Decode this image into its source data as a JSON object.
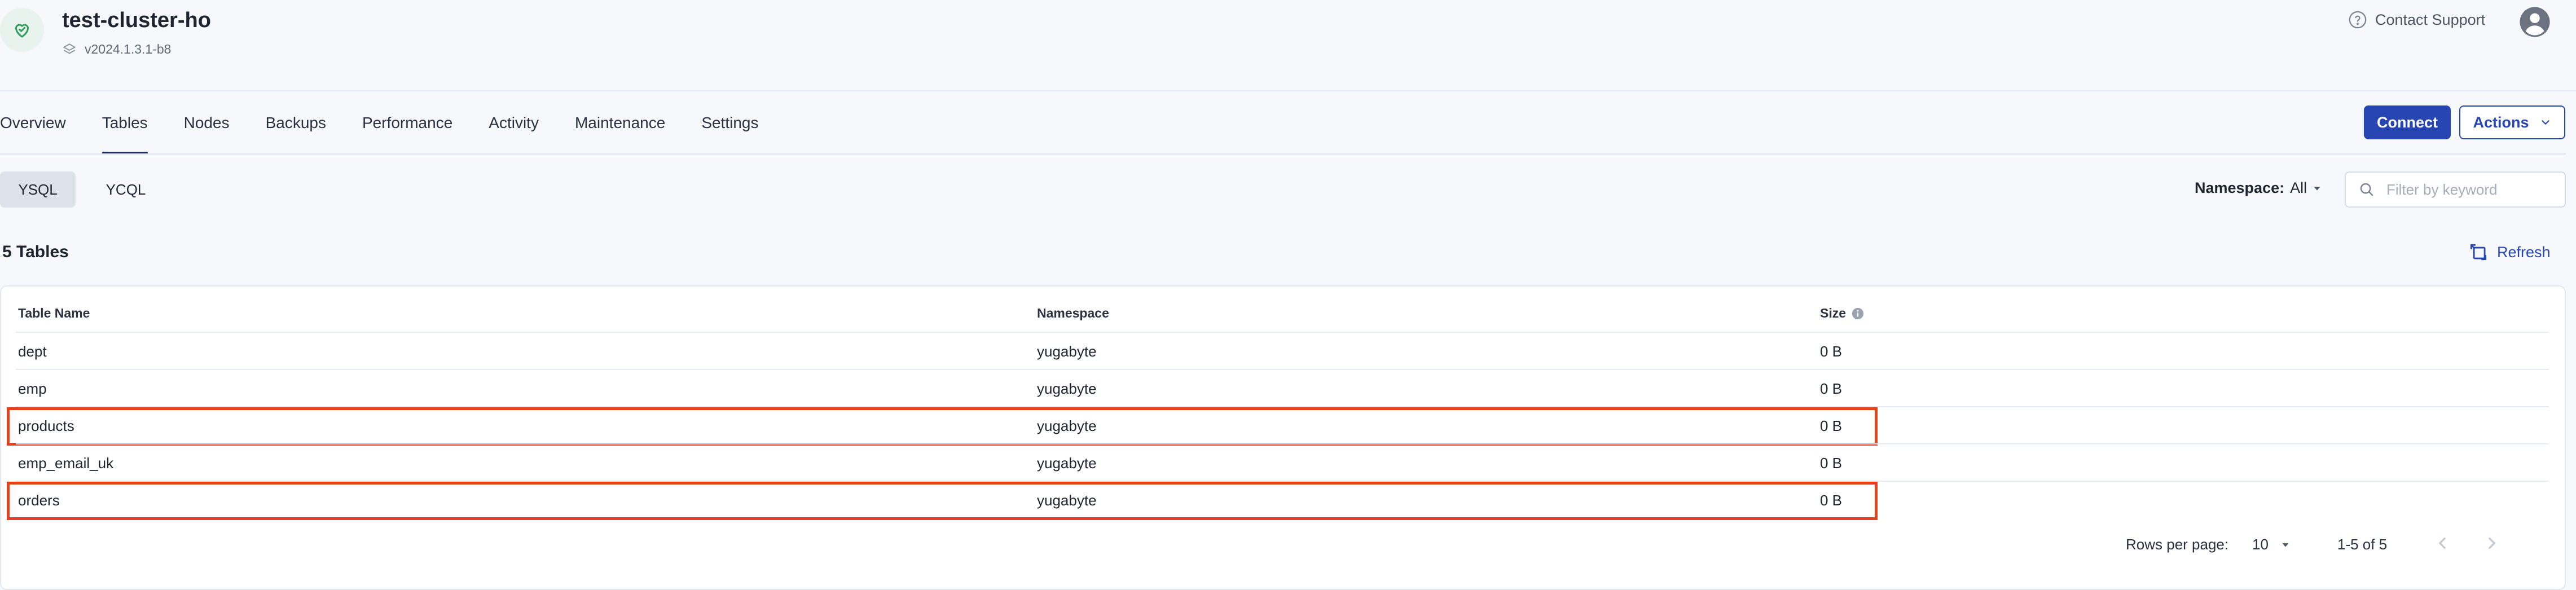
{
  "header": {
    "cluster_name": "test-cluster-ho",
    "version": "v2024.1.3.1-b8",
    "contact_support": "Contact Support"
  },
  "tabs": [
    {
      "label": "Overview"
    },
    {
      "label": "Tables"
    },
    {
      "label": "Nodes"
    },
    {
      "label": "Backups"
    },
    {
      "label": "Performance"
    },
    {
      "label": "Activity"
    },
    {
      "label": "Maintenance"
    },
    {
      "label": "Settings"
    }
  ],
  "actions": {
    "connect_label": "Connect",
    "actions_label": "Actions"
  },
  "api_tabs": {
    "ysql": "YSQL",
    "ycql": "YCQL"
  },
  "filter": {
    "namespace_label": "Namespace:",
    "namespace_value": "All",
    "search_placeholder": "Filter by keyword"
  },
  "table": {
    "count_title": "5 Tables",
    "refresh_label": "Refresh",
    "columns": [
      "Table Name",
      "Namespace",
      "Size"
    ],
    "rows": [
      {
        "name": "dept",
        "namespace": "yugabyte",
        "size": "0 B"
      },
      {
        "name": "emp",
        "namespace": "yugabyte",
        "size": "0 B"
      },
      {
        "name": "products",
        "namespace": "yugabyte",
        "size": "0 B"
      },
      {
        "name": "emp_email_uk",
        "namespace": "yugabyte",
        "size": "0 B"
      },
      {
        "name": "orders",
        "namespace": "yugabyte",
        "size": "0 B"
      }
    ]
  },
  "pagination": {
    "rows_per_page_label": "Rows per page:",
    "rows_per_page_value": "10",
    "range": "1-5 of 5"
  },
  "colors": {
    "primary": "#2746b3",
    "active_tab_indicator": "#1c2d66",
    "highlight_border": "#e4421f",
    "status_ok": "#2f9e5a"
  }
}
